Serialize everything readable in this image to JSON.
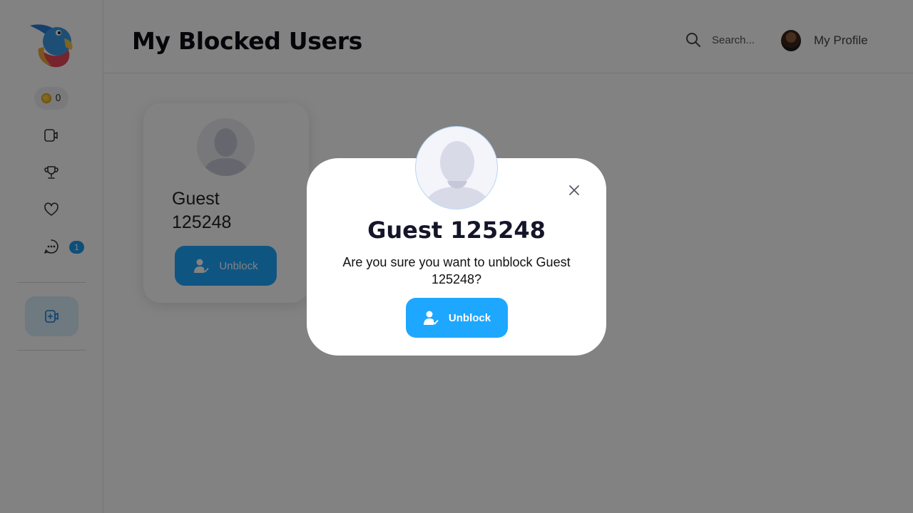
{
  "sidebar": {
    "coins": "0",
    "chat_badge": "1",
    "icons": [
      "video-chat-icon",
      "trophy-icon",
      "heart-icon",
      "chat-icon",
      "go-live-icon"
    ]
  },
  "header": {
    "title": "My Blocked Users",
    "search_placeholder": "Search...",
    "profile_label": "My Profile"
  },
  "card": {
    "name": "Guest 125248",
    "unblock_label": "Unblock"
  },
  "modal": {
    "title": "Guest 125248",
    "message": "Are you sure you want to unblock Guest 125248?",
    "unblock_label": "Unblock"
  },
  "colors": {
    "accent": "#1ea7ff",
    "badge": "#1d9bf0",
    "overlay": "rgba(0,0,0,0.49)"
  }
}
